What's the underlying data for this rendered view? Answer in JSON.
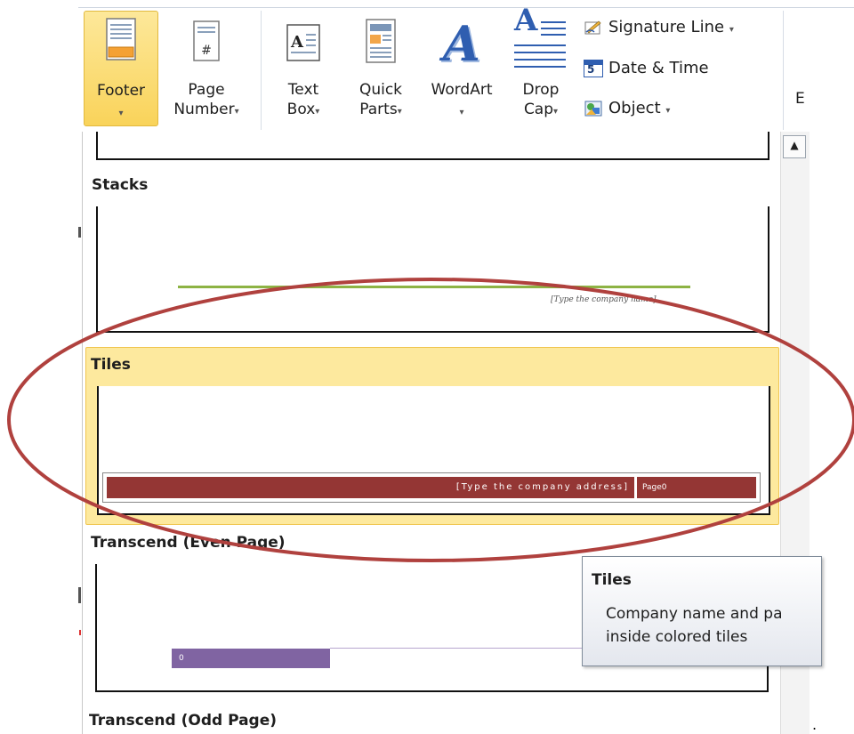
{
  "ribbon": {
    "footer": {
      "label": "Footer",
      "arrow": "▾",
      "icon": "footer-icon"
    },
    "page_number": {
      "label1": "Page",
      "label2": "Number",
      "arrow": "▾",
      "icon": "page-number-icon"
    },
    "text_box": {
      "label1": "Text",
      "label2": "Box",
      "arrow": "▾",
      "icon": "text-box-icon"
    },
    "quick_parts": {
      "label1": "Quick",
      "label2": "Parts",
      "arrow": "▾",
      "icon": "quick-parts-icon"
    },
    "wordart": {
      "label": "WordArt",
      "arrow": "▾",
      "icon": "wordart-icon",
      "glyph": "A"
    },
    "drop_cap": {
      "label1": "Drop",
      "label2": "Cap",
      "arrow": "▾",
      "icon": "drop-cap-icon",
      "glyph": "A"
    },
    "signature_line": {
      "label": "Signature Line",
      "arrow": "▾",
      "icon": "signature-icon"
    },
    "date_time": {
      "label": "Date & Time",
      "icon": "calendar-icon",
      "glyph": "5"
    },
    "object": {
      "label": "Object",
      "arrow": "▾",
      "icon": "object-icon"
    },
    "cut_letter": "E"
  },
  "gallery": {
    "sections": {
      "stacks": {
        "title": "Stacks",
        "company_placeholder": "[Type the company name]"
      },
      "tiles": {
        "title": "Tiles",
        "address_placeholder": "[Type the company address]",
        "page_text": "Page0"
      },
      "transcend_even": {
        "title": "Transcend (Even Page)",
        "page_num": "0"
      },
      "transcend_odd": {
        "title": "Transcend (Odd Page)"
      }
    },
    "scroll_up": "▲",
    "dot": "."
  },
  "tooltip": {
    "title": "Tiles",
    "line1": "Company name and pa",
    "line2": "inside colored tiles"
  },
  "colors": {
    "selection": "#fde99e",
    "tile_red": "#943634",
    "stacks_green": "#8db344",
    "transcend_purple": "#8064a2",
    "annotation_oval": "#b0413e"
  }
}
